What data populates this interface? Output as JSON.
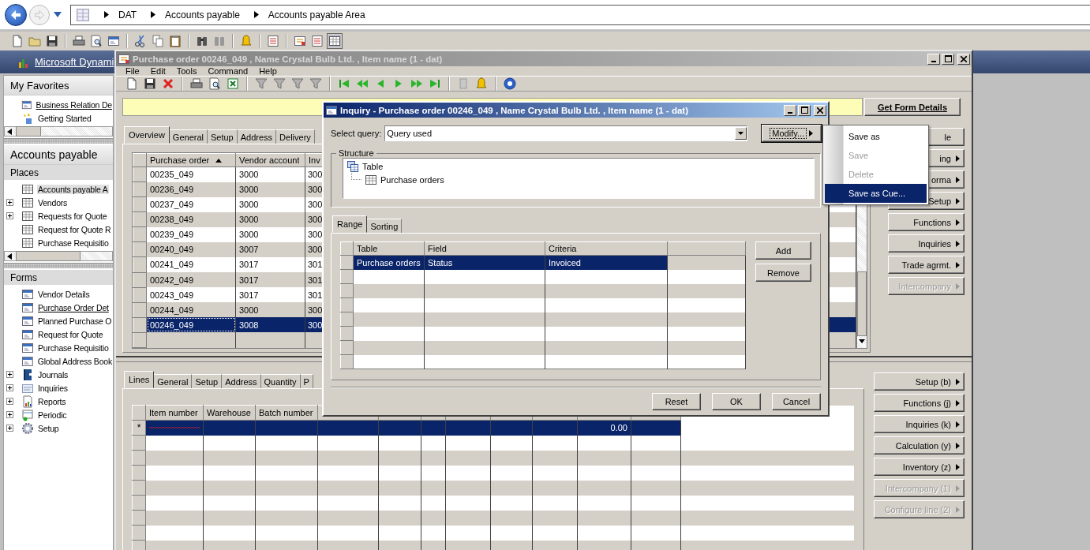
{
  "address_bar": {
    "breadcrumb": [
      "DAT",
      "Accounts payable",
      "Accounts payable Area"
    ]
  },
  "navigation_pane": {
    "banner": "Microsoft Dynami",
    "favorites": {
      "title": "My Favorites",
      "items": [
        {
          "label": "Business Relation De",
          "underlined": true
        },
        {
          "label": "Getting Started",
          "underlined": false
        }
      ]
    },
    "module_title": "Accounts payable",
    "places": {
      "title": "Places",
      "items": [
        {
          "label": "Accounts payable A",
          "selected": true
        },
        {
          "label": "Vendors",
          "selected": false,
          "expanded": false
        },
        {
          "label": "Requests for Quote",
          "selected": false,
          "expanded": false
        },
        {
          "label": "Request for Quote R",
          "selected": false
        },
        {
          "label": "Purchase Requisitio",
          "selected": false
        }
      ]
    },
    "forms": {
      "title": "Forms",
      "items": [
        {
          "label": "Vendor Details",
          "underlined": false
        },
        {
          "label": "Purchase Order Det",
          "underlined": true
        },
        {
          "label": "Planned Purchase O",
          "underlined": false
        },
        {
          "label": "Request for Quote",
          "underlined": false
        },
        {
          "label": "Purchase Requisitio",
          "underlined": false
        },
        {
          "label": "Global Address Book",
          "underlined": false
        }
      ]
    },
    "tree": [
      {
        "label": "Journals",
        "expanded": false
      },
      {
        "label": "Inquiries",
        "expanded": false
      },
      {
        "label": "Reports",
        "expanded": false
      },
      {
        "label": "Periodic",
        "expanded": false
      },
      {
        "label": "Setup",
        "expanded": false
      }
    ]
  },
  "purchase_order_window": {
    "title": "Purchase order 00246_049 , Name Crystal Bulb Ltd. , Item name (1 - dat)",
    "active": false,
    "menu": [
      "File",
      "Edit",
      "Tools",
      "Command",
      "Help"
    ],
    "get_form_details": "Get Form Details",
    "header_tabs": [
      {
        "label": "Overview",
        "selected": true
      },
      {
        "label": "General",
        "selected": false
      },
      {
        "label": "Setup",
        "selected": false
      },
      {
        "label": "Address",
        "selected": false
      },
      {
        "label": "Delivery",
        "selected": false
      }
    ],
    "header_grid": {
      "columns": [
        {
          "label": "Purchase order",
          "sorted": true
        },
        {
          "label": "Vendor account",
          "sorted": false
        },
        {
          "label": "Inv"
        }
      ],
      "rows": [
        {
          "cells": [
            "00235_049",
            "3000",
            "300"
          ],
          "selected": false
        },
        {
          "cells": [
            "00236_049",
            "3000",
            "300"
          ],
          "selected": false
        },
        {
          "cells": [
            "00237_049",
            "3000",
            "300"
          ],
          "selected": false
        },
        {
          "cells": [
            "00238_049",
            "3000",
            "300"
          ],
          "selected": false
        },
        {
          "cells": [
            "00239_049",
            "3000",
            "300"
          ],
          "selected": false
        },
        {
          "cells": [
            "00240_049",
            "3007",
            "300"
          ],
          "selected": false
        },
        {
          "cells": [
            "00241_049",
            "3017",
            "301"
          ],
          "selected": false
        },
        {
          "cells": [
            "00242_049",
            "3017",
            "301"
          ],
          "selected": false
        },
        {
          "cells": [
            "00243_049",
            "3017",
            "301"
          ],
          "selected": false
        },
        {
          "cells": [
            "00244_049",
            "3000",
            "300"
          ],
          "selected": false
        },
        {
          "cells": [
            "00246_049",
            "3008",
            "300"
          ],
          "selected": true
        }
      ]
    },
    "header_buttons": [
      {
        "label": "le",
        "submenu": false,
        "disabled": false
      },
      {
        "label": "ing",
        "submenu": true,
        "disabled": false
      },
      {
        "label": "orma",
        "submenu": true,
        "disabled": false
      },
      {
        "label": "Setup",
        "submenu": true,
        "disabled": false
      },
      {
        "label": "Functions",
        "submenu": true,
        "disabled": false
      },
      {
        "label": "Inquiries",
        "submenu": true,
        "disabled": false
      },
      {
        "label": "Trade agrmt.",
        "submenu": true,
        "disabled": false
      },
      {
        "label": "Intercompany",
        "submenu": true,
        "disabled": true
      }
    ],
    "line_tabs": [
      {
        "label": "Lines",
        "selected": true
      },
      {
        "label": "General",
        "selected": false
      },
      {
        "label": "Setup",
        "selected": false
      },
      {
        "label": "Address",
        "selected": false
      },
      {
        "label": "Quantity",
        "selected": false
      },
      {
        "label": "P",
        "selected": false
      }
    ],
    "lines_grid": {
      "columns": [
        {
          "label": "Item number"
        },
        {
          "label": "Warehouse"
        },
        {
          "label": "Batch number"
        },
        {},
        {},
        {},
        {},
        {},
        {},
        {},
        {}
      ],
      "new_row": {
        "marker": "*",
        "selected": true,
        "cells": [
          null,
          null,
          null,
          null,
          null,
          null,
          null,
          null,
          null,
          "0.00",
          null
        ]
      }
    },
    "line_buttons": [
      {
        "label": "Setup (b)",
        "disabled": false
      },
      {
        "label": "Functions (j)",
        "disabled": false
      },
      {
        "label": "Inquiries (k)",
        "disabled": false
      },
      {
        "label": "Calculation (y)",
        "disabled": false
      },
      {
        "label": "Inventory (z)",
        "disabled": false
      },
      {
        "label": "Intercompany (1)",
        "disabled": true
      },
      {
        "label": "Configure line (2)",
        "disabled": true
      }
    ]
  },
  "inquiry_dialog": {
    "title": "Inquiry - Purchase order 00246_049 , Name Crystal Bulb Ltd. , Item name (1 - dat)",
    "active": true,
    "query_label": "Select query:",
    "query_value": "Query used",
    "modify_button": "Modify...",
    "structure": {
      "title": "Structure",
      "tree": [
        {
          "label": "Table",
          "children": [
            {
              "label": "Purchase orders"
            }
          ]
        }
      ]
    },
    "tabs": [
      {
        "label": "Range",
        "selected": true
      },
      {
        "label": "Sorting",
        "selected": false
      }
    ],
    "range_grid": {
      "columns": [
        "Table",
        "Field",
        "Criteria"
      ],
      "rows": [
        {
          "cells": [
            "Purchase orders",
            "Status",
            "Invoiced"
          ],
          "selected": true
        }
      ]
    },
    "side_buttons": [
      "Add",
      "Remove"
    ],
    "buttons": [
      "Reset",
      "OK",
      "Cancel"
    ]
  },
  "context_menu": {
    "items": [
      {
        "label": "Save as",
        "disabled": false,
        "selected": false
      },
      {
        "label": "Save",
        "disabled": true,
        "selected": false
      },
      {
        "label": "Delete",
        "disabled": true,
        "selected": false
      },
      {
        "label": "Save as Cue...",
        "disabled": false,
        "selected": true
      }
    ]
  }
}
